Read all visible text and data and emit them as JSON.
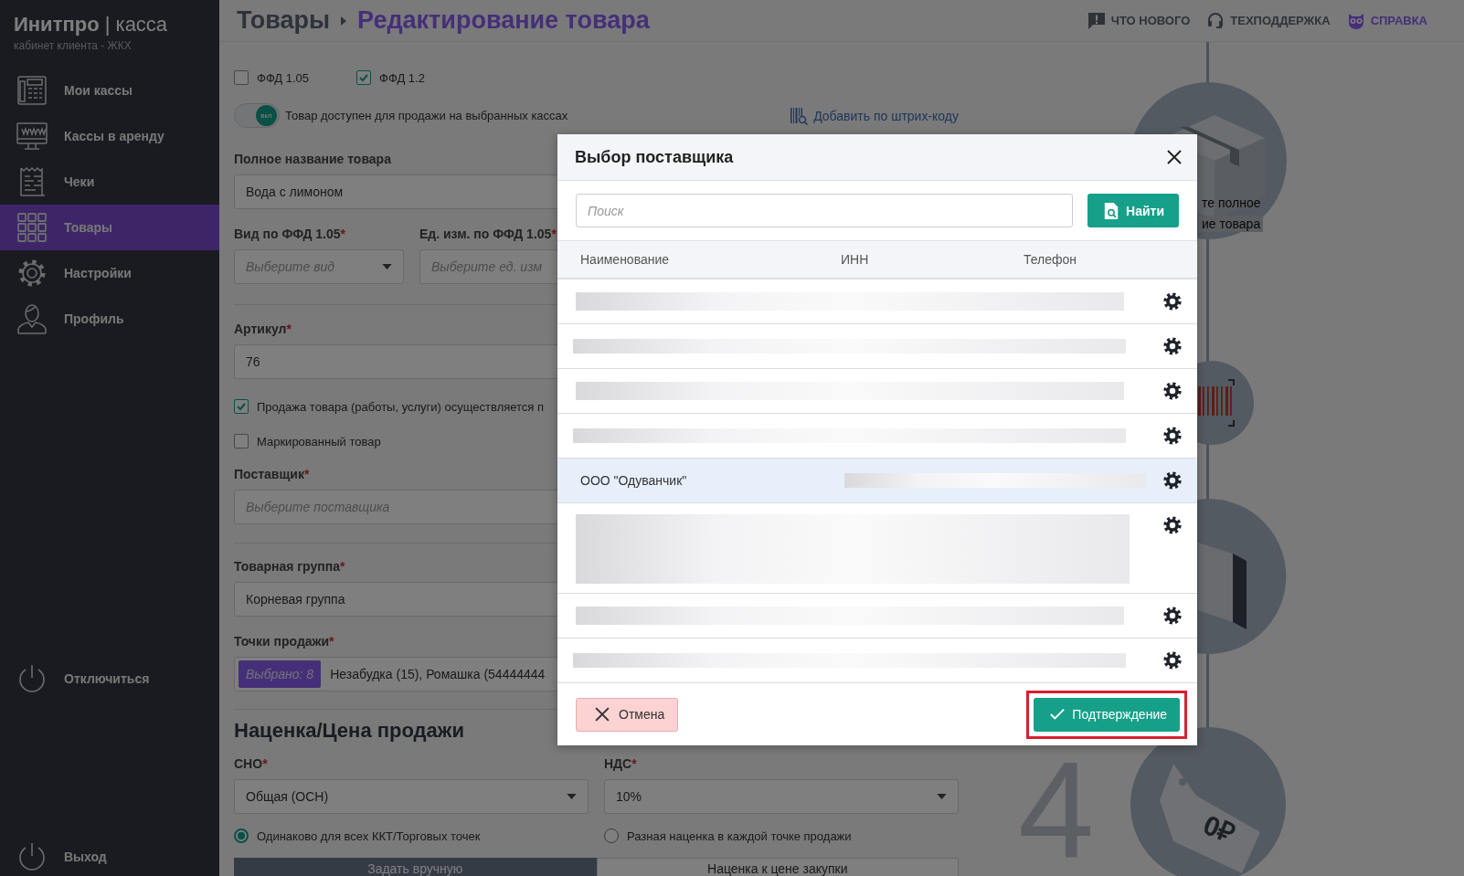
{
  "sidebar": {
    "logo": "**Инитпро** | касса",
    "subtitle": "кабинет клиента - ЖКХ",
    "items": [
      {
        "label": "Мои кассы",
        "selected": false
      },
      {
        "label": "Кассы в аренду",
        "selected": false
      },
      {
        "label": "Чеки",
        "selected": false
      },
      {
        "label": "Товары",
        "selected": true
      },
      {
        "label": "Настройки",
        "selected": false
      },
      {
        "label": "Профиль",
        "selected": false
      }
    ],
    "bottom_items": [
      "Отключиться",
      "Выход"
    ]
  },
  "header": {
    "breadcrumb": [
      "Товары",
      "Редактирование товара"
    ],
    "links": [
      "ЧТО НОВОГО",
      "ТЕХПОДДЕРЖКА",
      "СПРАВКА"
    ]
  },
  "form": {
    "ffd": [
      {
        "label": "ФФД 1.05",
        "checked": false
      },
      {
        "label": "ФФД 1.2",
        "checked": true
      }
    ],
    "availability": {
      "on": true,
      "knob": "вкл",
      "label": "Товар доступен для продажи на выбранных кассах"
    },
    "barcode_link": "Добавить по штрих-коду",
    "full_name": {
      "label": "Полное название товара",
      "value": "Вода с лимоном"
    },
    "type_select": {
      "label": "Вид по ФФД 1.05",
      "required_mark": "*",
      "placeholder": "Выберите вид"
    },
    "unit_select": {
      "label": "Ед. изм. по ФФД 1.05",
      "required_mark": "*",
      "placeholder": "Выберите ед. изм"
    },
    "article": {
      "label": "Артикул",
      "required_mark": "*",
      "value": "76"
    },
    "options": [
      {
        "label": "Продажа товара (работы, услуги) осуществляется п",
        "checked": true
      },
      {
        "label": "Маркированный товар",
        "checked": false
      }
    ],
    "supplier": {
      "label": "Поставщик",
      "required_mark": "*",
      "placeholder": "Выберите поставщика"
    },
    "group": {
      "label": "Товарная группа",
      "required_mark": "*",
      "value": "Корневая группа"
    },
    "points": {
      "label": "Точки продажи",
      "required_mark": "*",
      "badge": "Выбрано: 8",
      "value": "Незабудка (15), Ромашка (54444444"
    },
    "pricing": {
      "heading": "Наценка/Цена продажи",
      "tax_system": {
        "label": "СНО",
        "required_mark": "*",
        "value": "Общая (ОСН)"
      },
      "vat": {
        "label": "НДС",
        "required_mark": "*",
        "value": "10%"
      },
      "modes": [
        {
          "label": "Одинаково для всех ККТ/Торговых точек",
          "selected": true
        },
        {
          "label": "Разная наценка в каждой точке продажи",
          "selected": false
        }
      ],
      "tabs": [
        {
          "label": "Задать вручную",
          "selected": true
        },
        {
          "label": "Наценка к цене закупки",
          "selected": false
        }
      ]
    }
  },
  "steps": {
    "hint": [
      "те полное",
      "ие товара"
    ],
    "number": "4",
    "tag_label": "0₽"
  },
  "modal": {
    "title": "Выбор поставщика",
    "search": {
      "placeholder": "Поиск"
    },
    "search_button": "Найти",
    "columns": [
      "Наименование",
      "ИНН",
      "Телефон"
    ],
    "rows": [
      {
        "kind": "redacted",
        "selected": false
      },
      {
        "kind": "redacted",
        "selected": false
      },
      {
        "kind": "redacted",
        "selected": false
      },
      {
        "kind": "redacted",
        "selected": false
      },
      {
        "kind": "named",
        "name": "ООО \"Одуванчик\"",
        "selected": true
      },
      {
        "kind": "redacted_tall",
        "selected": false
      },
      {
        "kind": "redacted",
        "selected": false
      },
      {
        "kind": "redacted",
        "selected": false
      }
    ],
    "cancel": "Отмена",
    "confirm": "Подтверждение",
    "confirm_highlighted": true
  }
}
